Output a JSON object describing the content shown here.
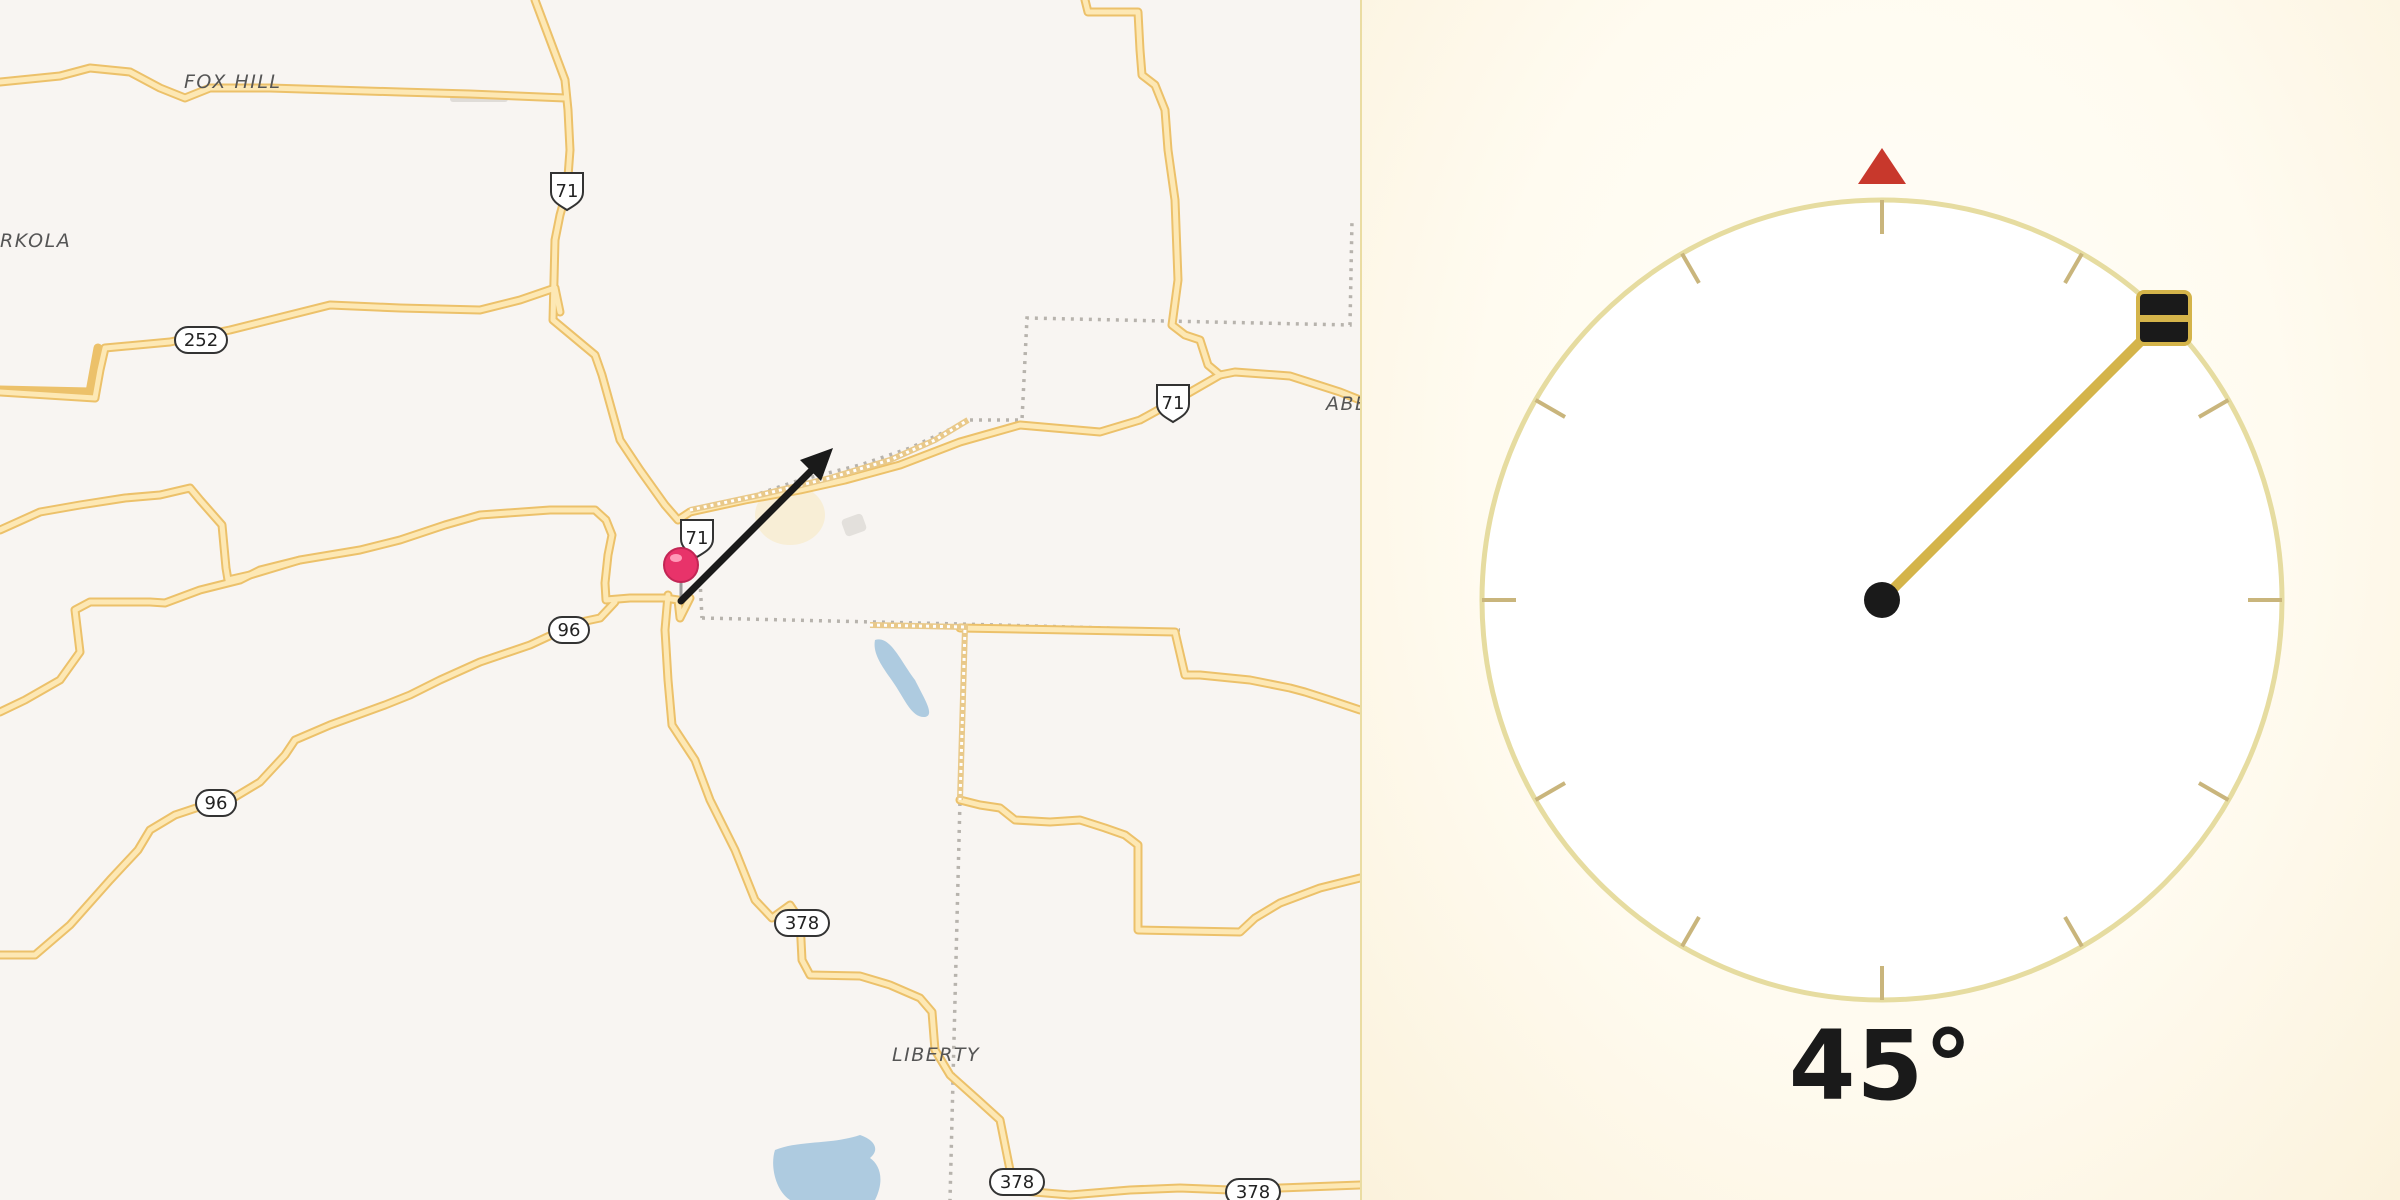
{
  "map": {
    "places": [
      "FOX HILL",
      "RKOLA",
      "ABE",
      "LIBERTY"
    ],
    "route_shields": {
      "us71_a": "71",
      "us71_b": "71",
      "us71_c": "71",
      "r252": "252",
      "r96_a": "96",
      "r96_b": "96",
      "r378_a": "378",
      "r378_b": "378",
      "r378_c": "378"
    },
    "marker_icon": "map-pin-icon",
    "heading_arrow_icon": "direction-arrow-icon"
  },
  "compass": {
    "heading_degrees": 45,
    "readout": "45°",
    "north_marker_icon": "north-triangle-icon",
    "handle_icon": "dial-handle-icon",
    "colors": {
      "ring": "#e6dca0",
      "needle": "#d4b44a",
      "north": "#c8382c",
      "tick": "#c9b57c"
    }
  }
}
